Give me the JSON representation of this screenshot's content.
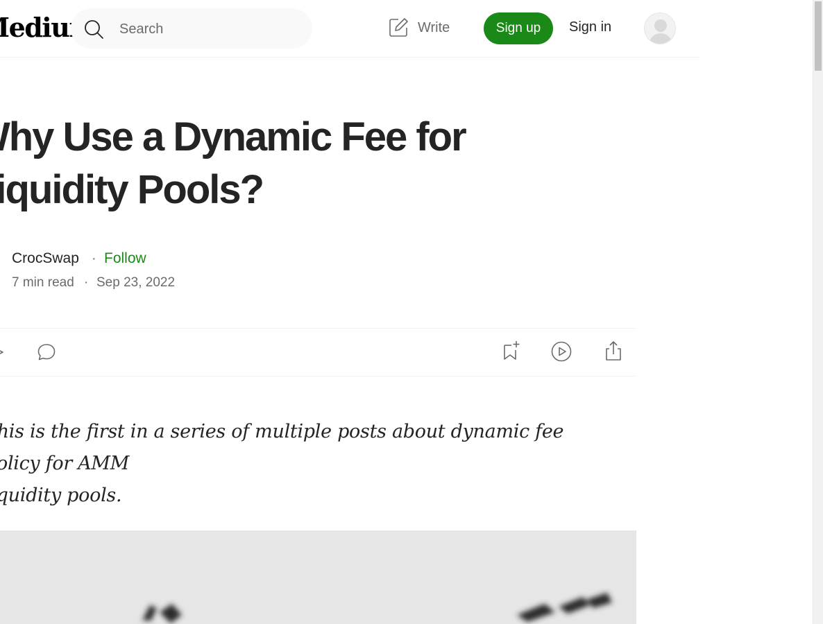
{
  "header": {
    "logo_text": "Medium",
    "search_placeholder": "Search",
    "write_label": "Write",
    "signup_label": "Sign up",
    "signin_label": "Sign in"
  },
  "article": {
    "title_line1": "Why Use a Dynamic Fee for",
    "title_line2": "Liquidity Pools?",
    "author": "CrocSwap",
    "separator": "·",
    "follow_label": "Follow",
    "read_time": "7 min read",
    "date": "Sep 23, 2022",
    "lead_line1": "This is the first in a series of multiple posts about dynamic fee policy for AMM",
    "lead_line2": "liquidity pools."
  },
  "actions": {
    "icons": [
      "clap-icon",
      "comment-icon",
      "bookmark-add-icon",
      "play-icon",
      "share-icon"
    ]
  },
  "colors": {
    "accent": "#1a8917",
    "text": "#242424",
    "muted": "#6b6b6b",
    "border": "#f2f2f2"
  }
}
